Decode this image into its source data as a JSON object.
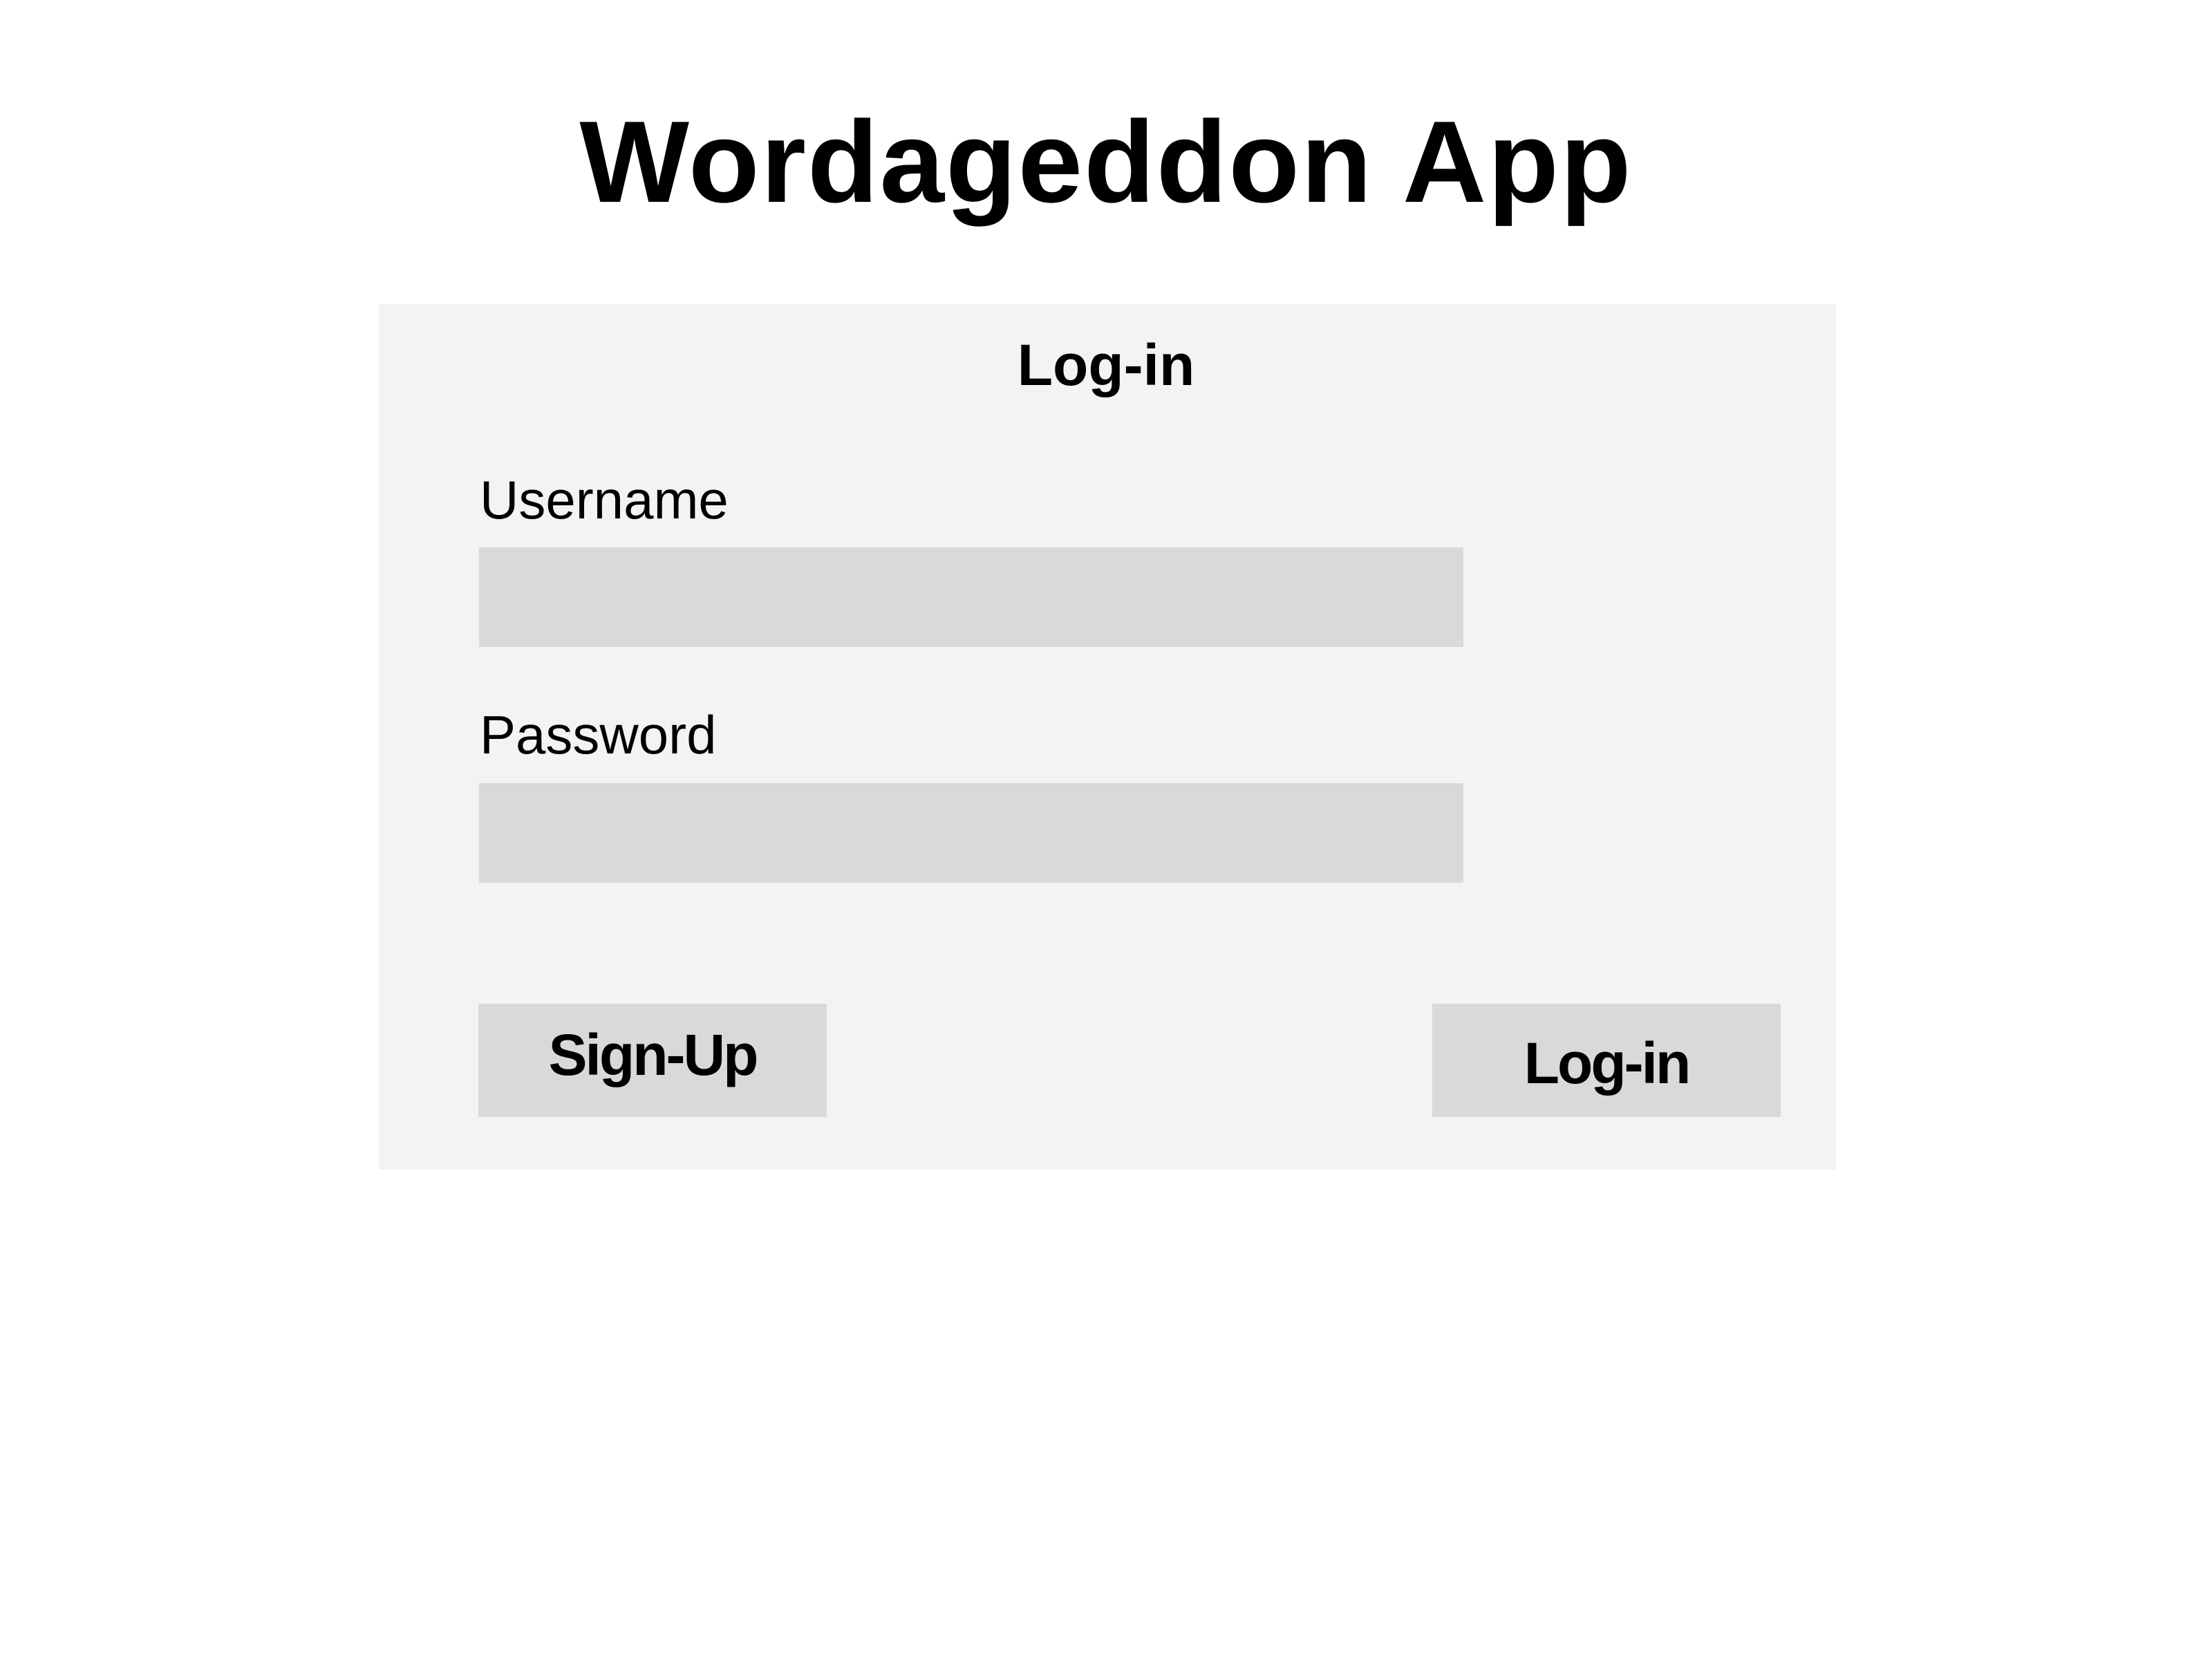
{
  "app": {
    "title": "Wordageddon App"
  },
  "login_form": {
    "heading": "Log-in",
    "username": {
      "label": "Username",
      "value": "",
      "placeholder": ""
    },
    "password": {
      "label": "Password",
      "value": "",
      "placeholder": ""
    },
    "signup_button": "Sign-Up",
    "login_button": "Log-in"
  },
  "colors": {
    "background": "#ffffff",
    "card": "#f3f3f3",
    "field": "#d9d9d9"
  }
}
